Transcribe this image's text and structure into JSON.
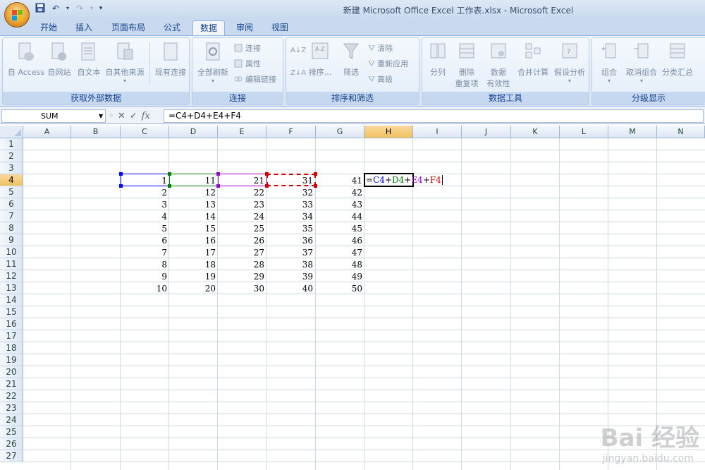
{
  "window": {
    "title": "新建 Microsoft Office Excel 工作表.xlsx - Microsoft Excel"
  },
  "quick_access": {
    "save_icon": "save-icon",
    "undo_icon": "undo-icon",
    "redo_icon": "redo-icon",
    "customize_icon": "customize-qat-icon"
  },
  "tabs": [
    {
      "label": "开始"
    },
    {
      "label": "插入"
    },
    {
      "label": "页面布局"
    },
    {
      "label": "公式"
    },
    {
      "label": "数据",
      "active": true
    },
    {
      "label": "审阅"
    },
    {
      "label": "视图"
    }
  ],
  "ribbon": {
    "groups": [
      {
        "label": "获取外部数据",
        "buttons": [
          "自 Access",
          "自网站",
          "自文本",
          "自其他来源",
          "现有连接"
        ]
      },
      {
        "label": "连接",
        "buttons": [
          "全部刷新"
        ],
        "small_buttons": [
          "连接",
          "属性",
          "编辑链接"
        ]
      },
      {
        "label": "排序和筛选",
        "buttons": [
          "排序...",
          "筛选"
        ],
        "small_buttons": [
          "清除",
          "重新应用",
          "高级"
        ]
      },
      {
        "label": "数据工具",
        "buttons": [
          "分列",
          "删除",
          "重复项",
          "数据",
          "有效性",
          "合并计算",
          "假设分析"
        ]
      },
      {
        "label": "分级显示",
        "buttons": [
          "组合",
          "取消组合",
          "分类汇总"
        ]
      }
    ]
  },
  "formula_bar": {
    "name_box": "SUM",
    "formula": "=C4+D4+E4+F4",
    "cancel_icon": "cancel-icon",
    "enter_icon": "enter-icon",
    "fx_label": "fx"
  },
  "sheet": {
    "columns": [
      "A",
      "B",
      "C",
      "D",
      "E",
      "F",
      "G",
      "H",
      "I",
      "J",
      "K",
      "L",
      "M",
      "N"
    ],
    "selected_column": "H",
    "selected_row": 4,
    "rows": [
      "1",
      "2",
      "3",
      "4",
      "5",
      "6",
      "7",
      "8",
      "9",
      "10",
      "11",
      "12",
      "13",
      "14",
      "15",
      "16",
      "17",
      "18",
      "19",
      "20",
      "21",
      "22",
      "23",
      "24",
      "25",
      "26",
      "27"
    ],
    "data_C": [
      "1",
      "2",
      "3",
      "4",
      "5",
      "6",
      "7",
      "8",
      "9",
      "10"
    ],
    "data_D": [
      "11",
      "12",
      "13",
      "14",
      "15",
      "16",
      "17",
      "18",
      "19",
      "20"
    ],
    "data_E": [
      "21",
      "22",
      "23",
      "24",
      "25",
      "26",
      "27",
      "28",
      "29",
      "30"
    ],
    "data_F": [
      "31",
      "32",
      "33",
      "34",
      "35",
      "36",
      "37",
      "38",
      "39",
      "40"
    ],
    "data_G": [
      "41",
      "42",
      "43",
      "44",
      "45",
      "46",
      "47",
      "48",
      "49",
      "50"
    ],
    "edit_formula_parts": [
      {
        "text": "=",
        "color": "#000000"
      },
      {
        "text": "C4",
        "color": "#0000ff"
      },
      {
        "text": "+",
        "color": "#000000"
      },
      {
        "text": "D4",
        "color": "#008000"
      },
      {
        "text": "+",
        "color": "#000000"
      },
      {
        "text": "E4",
        "color": "#9900cc"
      },
      {
        "text": "+",
        "color": "#000000"
      },
      {
        "text": "F4",
        "color": "#cc0000"
      }
    ]
  },
  "watermark": {
    "brand": "Bai 经验",
    "url": "jingyan.baidu.com"
  }
}
